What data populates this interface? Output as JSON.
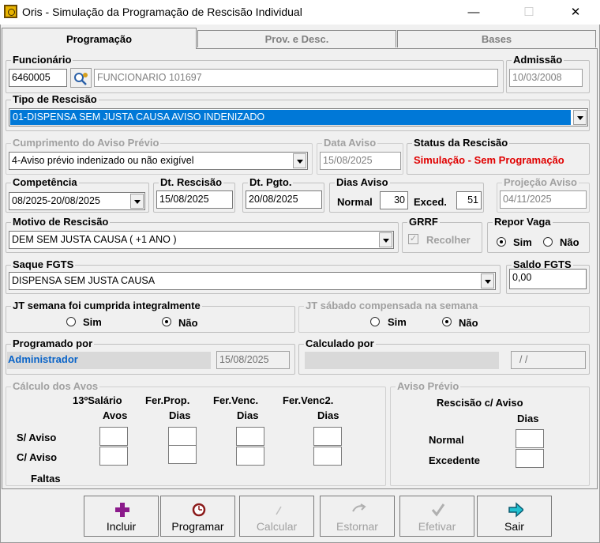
{
  "window": {
    "title": "Oris - Simulação da Programação de Rescisão Individual",
    "minimize": "—",
    "maximize": "☐",
    "close": "✕"
  },
  "tabs": [
    "Programação",
    "Prov. e Desc.",
    "Bases"
  ],
  "funcionario": {
    "legend": "Funcionário",
    "code": "6460005",
    "name": "FUNCIONARIO 101697"
  },
  "admissao": {
    "legend": "Admissão",
    "value": "10/03/2008"
  },
  "tipo_rescisao": {
    "legend": "Tipo de Rescisão",
    "value": "01-DISPENSA SEM JUSTA CAUSA AVISO INDENIZADO"
  },
  "cumprimento": {
    "legend": "Cumprimento do Aviso Prévio",
    "value": "4-Aviso prévio indenizado ou não exigível"
  },
  "data_aviso": {
    "legend": "Data Aviso",
    "value": "15/08/2025"
  },
  "status": {
    "legend": "Status da Rescisão",
    "value": "Simulação - Sem Programação"
  },
  "competencia": {
    "legend": "Competência",
    "value": "08/2025-20/08/2025"
  },
  "dt_rescisao": {
    "legend": "Dt. Rescisão",
    "value": "15/08/2025"
  },
  "dt_pgto": {
    "legend": "Dt. Pgto.",
    "value": "20/08/2025"
  },
  "dias_aviso": {
    "legend": "Dias Aviso",
    "normal_label": "Normal",
    "normal": "30",
    "exced_label": "Exced.",
    "exced": "51"
  },
  "projecao": {
    "legend": "Projeção Aviso",
    "value": "04/11/2025"
  },
  "motivo": {
    "legend": "Motivo de Rescisão",
    "value": "DEM SEM JUSTA CAUSA ( +1 ANO )"
  },
  "grrf": {
    "legend": "GRRF",
    "check": "✓",
    "label": "Recolher"
  },
  "repor": {
    "legend": "Repor Vaga",
    "sim": "Sim",
    "nao": "Não"
  },
  "saque": {
    "legend": "Saque FGTS",
    "value": "DISPENSA SEM JUSTA CAUSA"
  },
  "saldo": {
    "legend": "Saldo FGTS",
    "value": "0,00"
  },
  "jt_semana": {
    "legend": "JT semana foi cumprida integralmente",
    "sim": "Sim",
    "nao": "Não"
  },
  "jt_sabado": {
    "legend": "JT sábado compensada na semana",
    "sim": "Sim",
    "nao": "Não"
  },
  "programado": {
    "legend": "Programado por",
    "user": "Administrador",
    "date": "15/08/2025"
  },
  "calculado": {
    "legend": "Calculado por",
    "date": "/ /"
  },
  "calculo": {
    "legend": "Cálculo dos Avos",
    "h1a": "13ºSalário",
    "h1b": "Avos",
    "h2a": "Fer.Prop.",
    "h2b": "Dias",
    "h3a": "Fer.Venc.",
    "h3b": "Dias",
    "h4a": "Fer.Venc2.",
    "h4b": "Dias",
    "r1": "S/ Aviso",
    "r2": "C/ Aviso",
    "r3": "Faltas"
  },
  "aviso_previo": {
    "legend": "Aviso Prévio",
    "h1": "Rescisão c/ Aviso",
    "h2": "Dias",
    "r1": "Normal",
    "r2": "Excedente"
  },
  "buttons": {
    "incluir": "Incluir",
    "programar": "Programar",
    "calcular": "Calcular",
    "estornar": "Estornar",
    "efetivar": "Efetivar",
    "sair": "Sair"
  }
}
